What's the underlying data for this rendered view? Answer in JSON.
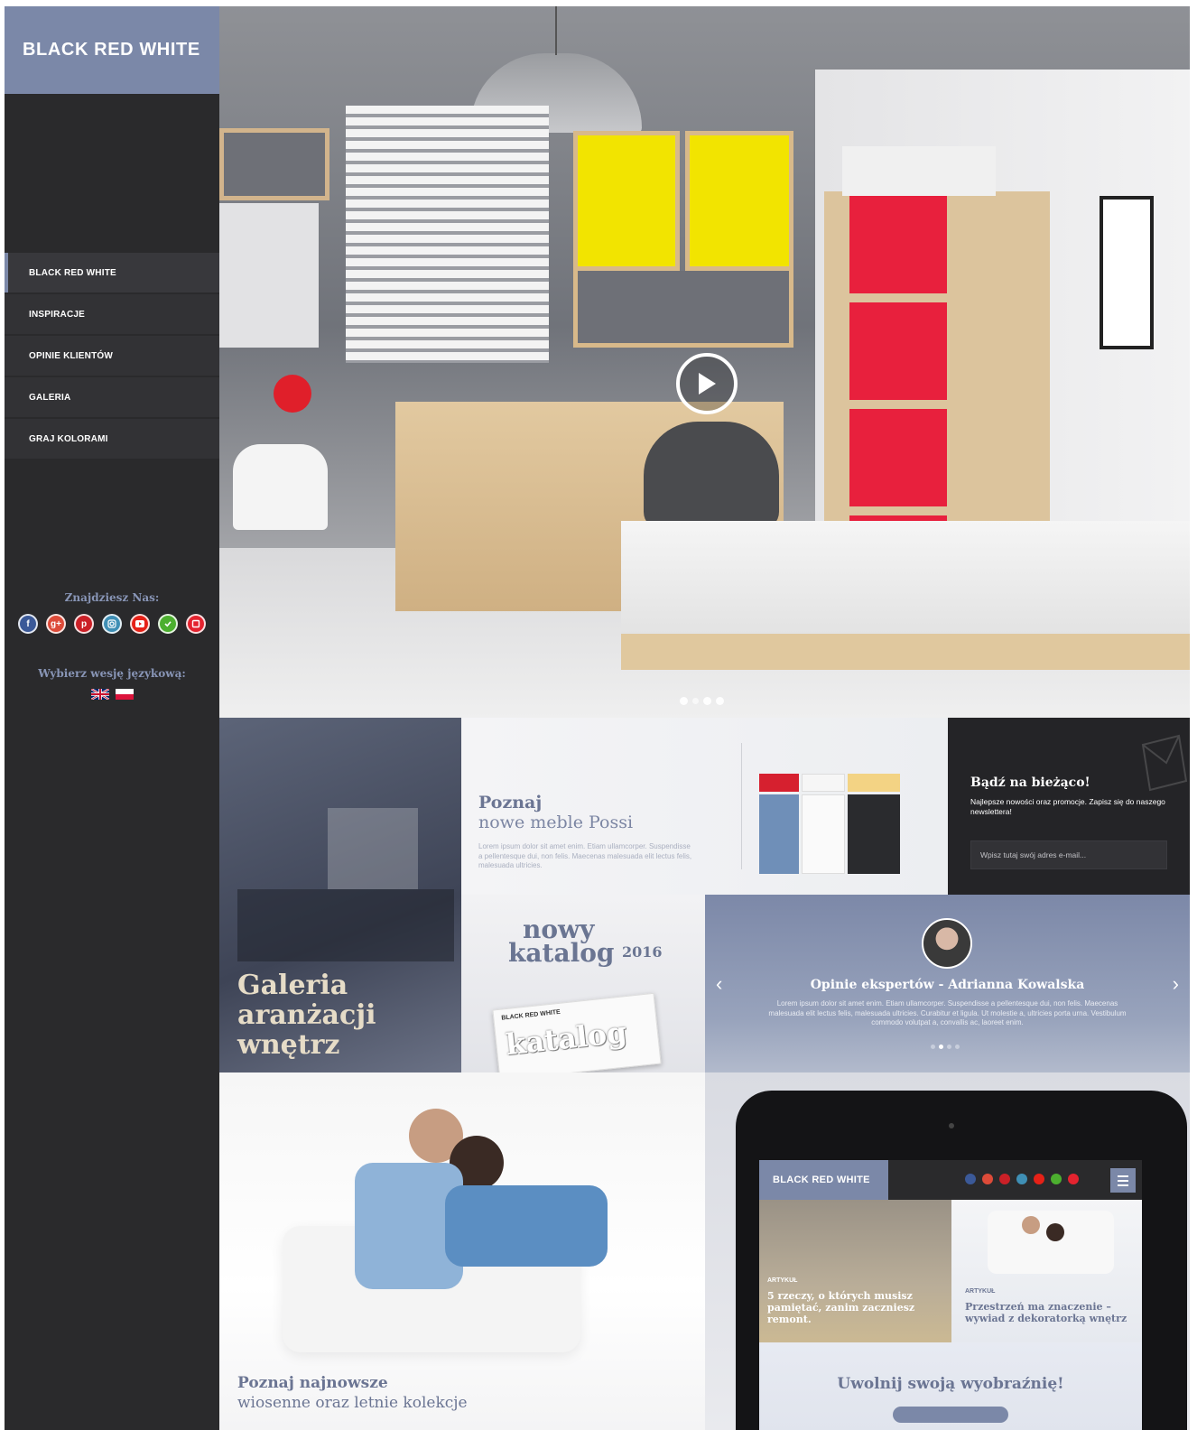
{
  "brand": {
    "name": "BLACK RED WHITE",
    "accent": "#7b88a8",
    "sidebar_bg": "#2a2a2c"
  },
  "nav": {
    "items": [
      {
        "label": "BLACK RED WHITE",
        "active": true
      },
      {
        "label": "INSPIRACJE",
        "active": false
      },
      {
        "label": "OPINIE KLIENTÓW",
        "active": false
      },
      {
        "label": "GALERIA",
        "active": false
      },
      {
        "label": "GRAJ KOLORAMI",
        "active": false
      }
    ]
  },
  "find_us": {
    "heading": "Znajdziesz Nas:",
    "icons": [
      "facebook-icon",
      "google-plus-icon",
      "pinterest-icon",
      "instagram-icon",
      "youtube-icon",
      "green-check-icon",
      "red-square-icon"
    ]
  },
  "language": {
    "heading": "Wybierz wesję językową:",
    "flags": [
      "uk-flag-icon",
      "poland-flag-icon"
    ]
  },
  "hero": {
    "play_icon": "play-icon",
    "slides": 4,
    "active_slide": 1
  },
  "gallery_tile": {
    "title": "Galeria\naranżacji\nwnętrz"
  },
  "possi_tile": {
    "title": "Poznaj",
    "subtitle": "nowe meble Possi",
    "description": "Lorem ipsum dolor sit amet enim. Etiam ullamcorper. Suspendisse a pellentesque dui, non felis. Maecenas malesuada elit lectus felis, malesuada ultricies."
  },
  "newsletter": {
    "title": "Bądź na bieżąco!",
    "description": "Najlepsze nowości oraz promocje. Zapisz się do naszego newslettera!",
    "placeholder": "Wpisz tutaj swój adres e-mail..."
  },
  "catalog_tile": {
    "line1": "nowy",
    "line2": "katalog",
    "year": "2016",
    "book_logo": "BLACK RED WHITE",
    "book_title": "katalog"
  },
  "experts": {
    "title": "Opinie ekspertów - Adrianna Kowalska",
    "description": "Lorem ipsum dolor sit amet enim. Etiam ullamcorper. Suspendisse a pellentesque dui, non felis. Maecenas malesuada elit lectus felis, malesuada ultricies. Curabitur et ligula. Ut molestie a, ultricies porta urna. Vestibulum commodo volutpat a, convallis ac, laoreet enim.",
    "prev": "‹",
    "next": "›",
    "slides": 4,
    "active_slide": 1
  },
  "couple_tile": {
    "title": "Poznaj najnowsze",
    "subtitle": "wiosenne oraz letnie kolekcje"
  },
  "tablet": {
    "logo": "BLACK RED WHITE",
    "article1": {
      "label": "ARTYKUŁ",
      "title": "5 rzeczy, o których musisz\npamiętać, zanim zaczniesz\nremont."
    },
    "article2": {
      "label": "ARTYKUŁ",
      "title": "Przestrzeń ma znaczenie –\nwywiad z dekoratorką wnętrz"
    },
    "slogan": "Uwolnij swoją wyobraźnię!"
  }
}
